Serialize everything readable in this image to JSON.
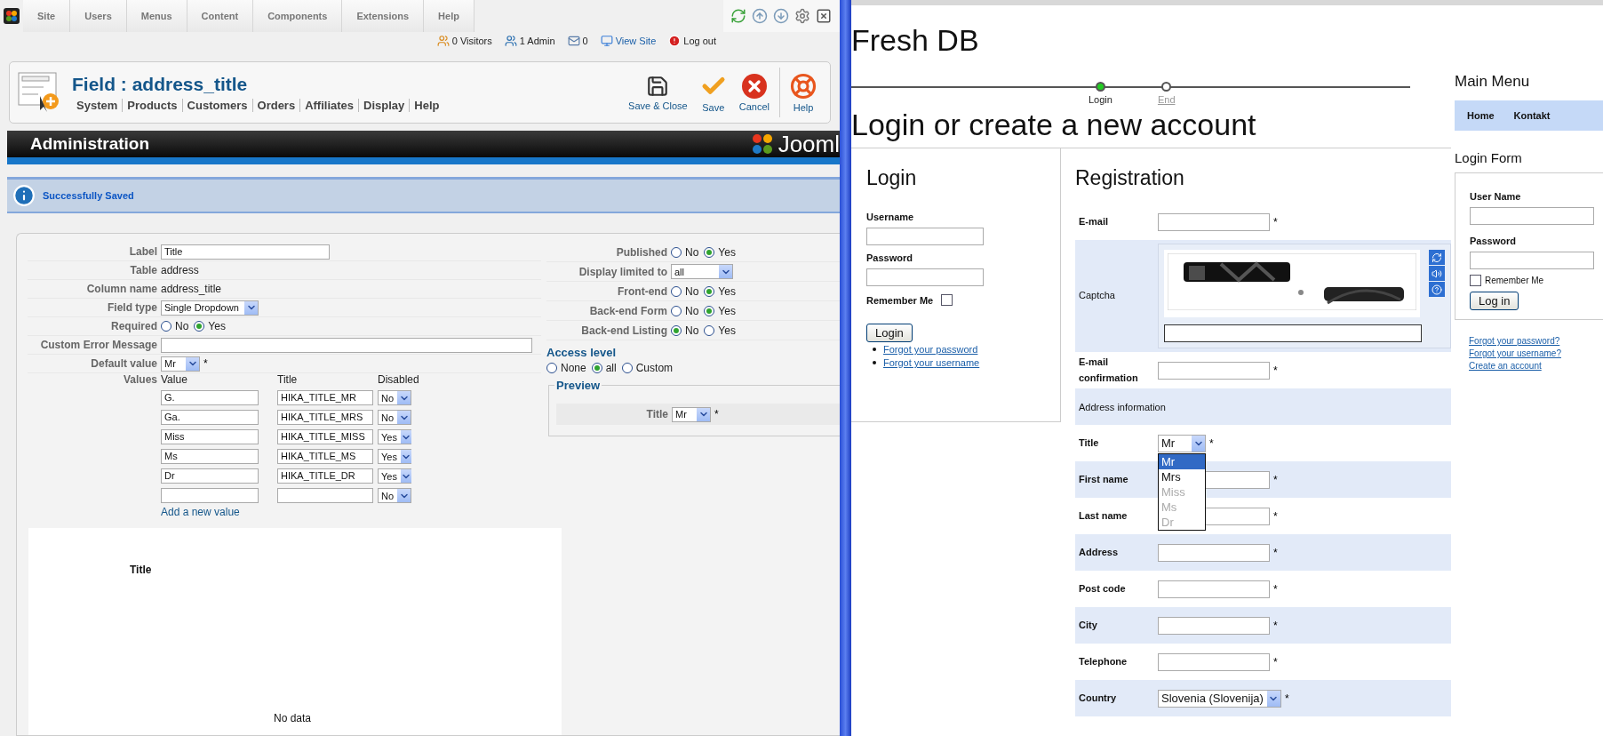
{
  "admin": {
    "menu": [
      "Site",
      "Users",
      "Menus",
      "Content",
      "Components",
      "Extensions",
      "Help"
    ],
    "status": [
      {
        "kind": "visitors",
        "text": "0 Visitors"
      },
      {
        "kind": "admins",
        "text": "1 Admin"
      },
      {
        "kind": "messages",
        "text": "0"
      },
      {
        "kind": "view",
        "text": "View Site"
      },
      {
        "kind": "logout",
        "text": "Log out"
      }
    ],
    "title": "Field : address_title",
    "submenu": [
      "System",
      "Products",
      "Customers",
      "Orders",
      "Affiliates",
      "Display",
      "Help"
    ],
    "actions": [
      {
        "kind": "save_close",
        "label": "Save & Close"
      },
      {
        "kind": "save",
        "label": "Save"
      },
      {
        "kind": "cancel",
        "label": "Cancel"
      },
      {
        "kind": "help",
        "label": "Help"
      }
    ],
    "banner": "Administration",
    "logo_text": "Jooml",
    "message": "Successfully Saved",
    "fields": [
      {
        "label": "Label",
        "kind": "input",
        "value": "Title"
      },
      {
        "label": "Table",
        "kind": "text",
        "value": "address"
      },
      {
        "label": "Column name",
        "kind": "text",
        "value": "address_title"
      },
      {
        "label": "Field type",
        "kind": "select",
        "value": "Single Dropdown"
      },
      {
        "label": "Required",
        "kind": "radio",
        "options": [
          {
            "label": "No",
            "selected": false
          },
          {
            "label": "Yes",
            "selected": true
          }
        ]
      },
      {
        "label": "Custom Error Message",
        "kind": "wide_input"
      },
      {
        "label": "Default value",
        "kind": "select",
        "value": "Mr",
        "mark": "*"
      }
    ],
    "values": {
      "label": "Values",
      "columns": [
        "Value",
        "Title",
        "Disabled"
      ],
      "rows": [
        {
          "value": "G.",
          "title": "HIKA_TITLE_MR",
          "disabled": "No"
        },
        {
          "value": "Ga.",
          "title": "HIKA_TITLE_MRS",
          "disabled": "No"
        },
        {
          "value": "Miss",
          "title": "HIKA_TITLE_MISS",
          "disabled": "Yes"
        },
        {
          "value": "Ms",
          "title": "HIKA_TITLE_MS",
          "disabled": "Yes"
        },
        {
          "value": "Dr",
          "title": "HIKA_TITLE_DR",
          "disabled": "Yes"
        },
        {
          "disabled": "No"
        }
      ],
      "add_link": "Add a new value"
    },
    "options": [
      {
        "label": "Published",
        "kind": "radio",
        "options": [
          {
            "label": "No",
            "selected": false
          },
          {
            "label": "Yes",
            "selected": true
          }
        ]
      },
      {
        "label": "Display limited to",
        "kind": "select",
        "value": "all"
      },
      {
        "label": "Front-end",
        "kind": "radio",
        "options": [
          {
            "label": "No",
            "selected": false
          },
          {
            "label": "Yes",
            "selected": true
          }
        ]
      },
      {
        "label": "Back-end Form",
        "kind": "radio",
        "options": [
          {
            "label": "No",
            "selected": false
          },
          {
            "label": "Yes",
            "selected": true
          }
        ]
      },
      {
        "label": "Back-end Listing",
        "kind": "radio",
        "options": [
          {
            "label": "No",
            "selected": true
          },
          {
            "label": "Yes",
            "selected": false
          }
        ]
      }
    ],
    "access": {
      "title": "Access level",
      "options": [
        {
          "label": "None",
          "selected": false
        },
        {
          "label": "all",
          "selected": true
        },
        {
          "label": "Custom",
          "selected": false
        }
      ]
    },
    "preview": {
      "legend": "Preview",
      "label": "Title",
      "value": "Mr",
      "mark": "*"
    },
    "data_panel": {
      "title": "Title",
      "empty": "No data"
    }
  },
  "site": {
    "title": "Fresh DB",
    "steps": [
      {
        "label": "Login",
        "selected": true
      },
      {
        "label": "End",
        "selected": false
      }
    ],
    "heading": "Login or create a new account",
    "login": {
      "title": "Login",
      "username": "Username",
      "password": "Password",
      "remember": "Remember Me",
      "remember_checked": false,
      "button": "Login",
      "links": [
        "Forgot your password",
        "Forgot your username"
      ]
    },
    "registration": {
      "title": "Registration",
      "rows": [
        {
          "kind": "input",
          "label": "E-mail",
          "mark": "*"
        },
        {
          "kind": "captcha",
          "label": "Captcha"
        },
        {
          "kind": "input",
          "label": "E-mail confirmation",
          "mark": "*"
        },
        {
          "kind": "section",
          "label": "Address information"
        },
        {
          "kind": "dropdown",
          "label": "Title",
          "value": "Mr",
          "mark": "*",
          "options": [
            {
              "label": "Mr",
              "selected": true,
              "disabled": false
            },
            {
              "label": "Mrs",
              "selected": false,
              "disabled": false
            },
            {
              "label": "Miss",
              "selected": false,
              "disabled": true
            },
            {
              "label": "Ms",
              "selected": false,
              "disabled": true
            },
            {
              "label": "Dr",
              "selected": false,
              "disabled": true
            }
          ]
        },
        {
          "kind": "input",
          "label": "First name",
          "mark": "*"
        },
        {
          "kind": "input",
          "label": "Last name",
          "mark": "*"
        },
        {
          "kind": "input",
          "label": "Address",
          "mark": "*"
        },
        {
          "kind": "input",
          "label": "Post code",
          "mark": "*"
        },
        {
          "kind": "input",
          "label": "City",
          "mark": "*"
        },
        {
          "kind": "input",
          "label": "Telephone",
          "mark": "*"
        },
        {
          "kind": "select",
          "label": "Country",
          "value": "Slovenia (Slovenija)",
          "mark": "*"
        }
      ]
    },
    "sidebar": {
      "menu_title": "Main Menu",
      "menu": [
        "Home",
        "Kontakt"
      ],
      "form_title": "Login Form",
      "user_name": "User Name",
      "password": "Password",
      "remember": "Remember Me",
      "remember_checked": false,
      "button": "Log in",
      "links": [
        "Forgot your password?",
        "Forgot your username?",
        "Create an account"
      ]
    }
  }
}
